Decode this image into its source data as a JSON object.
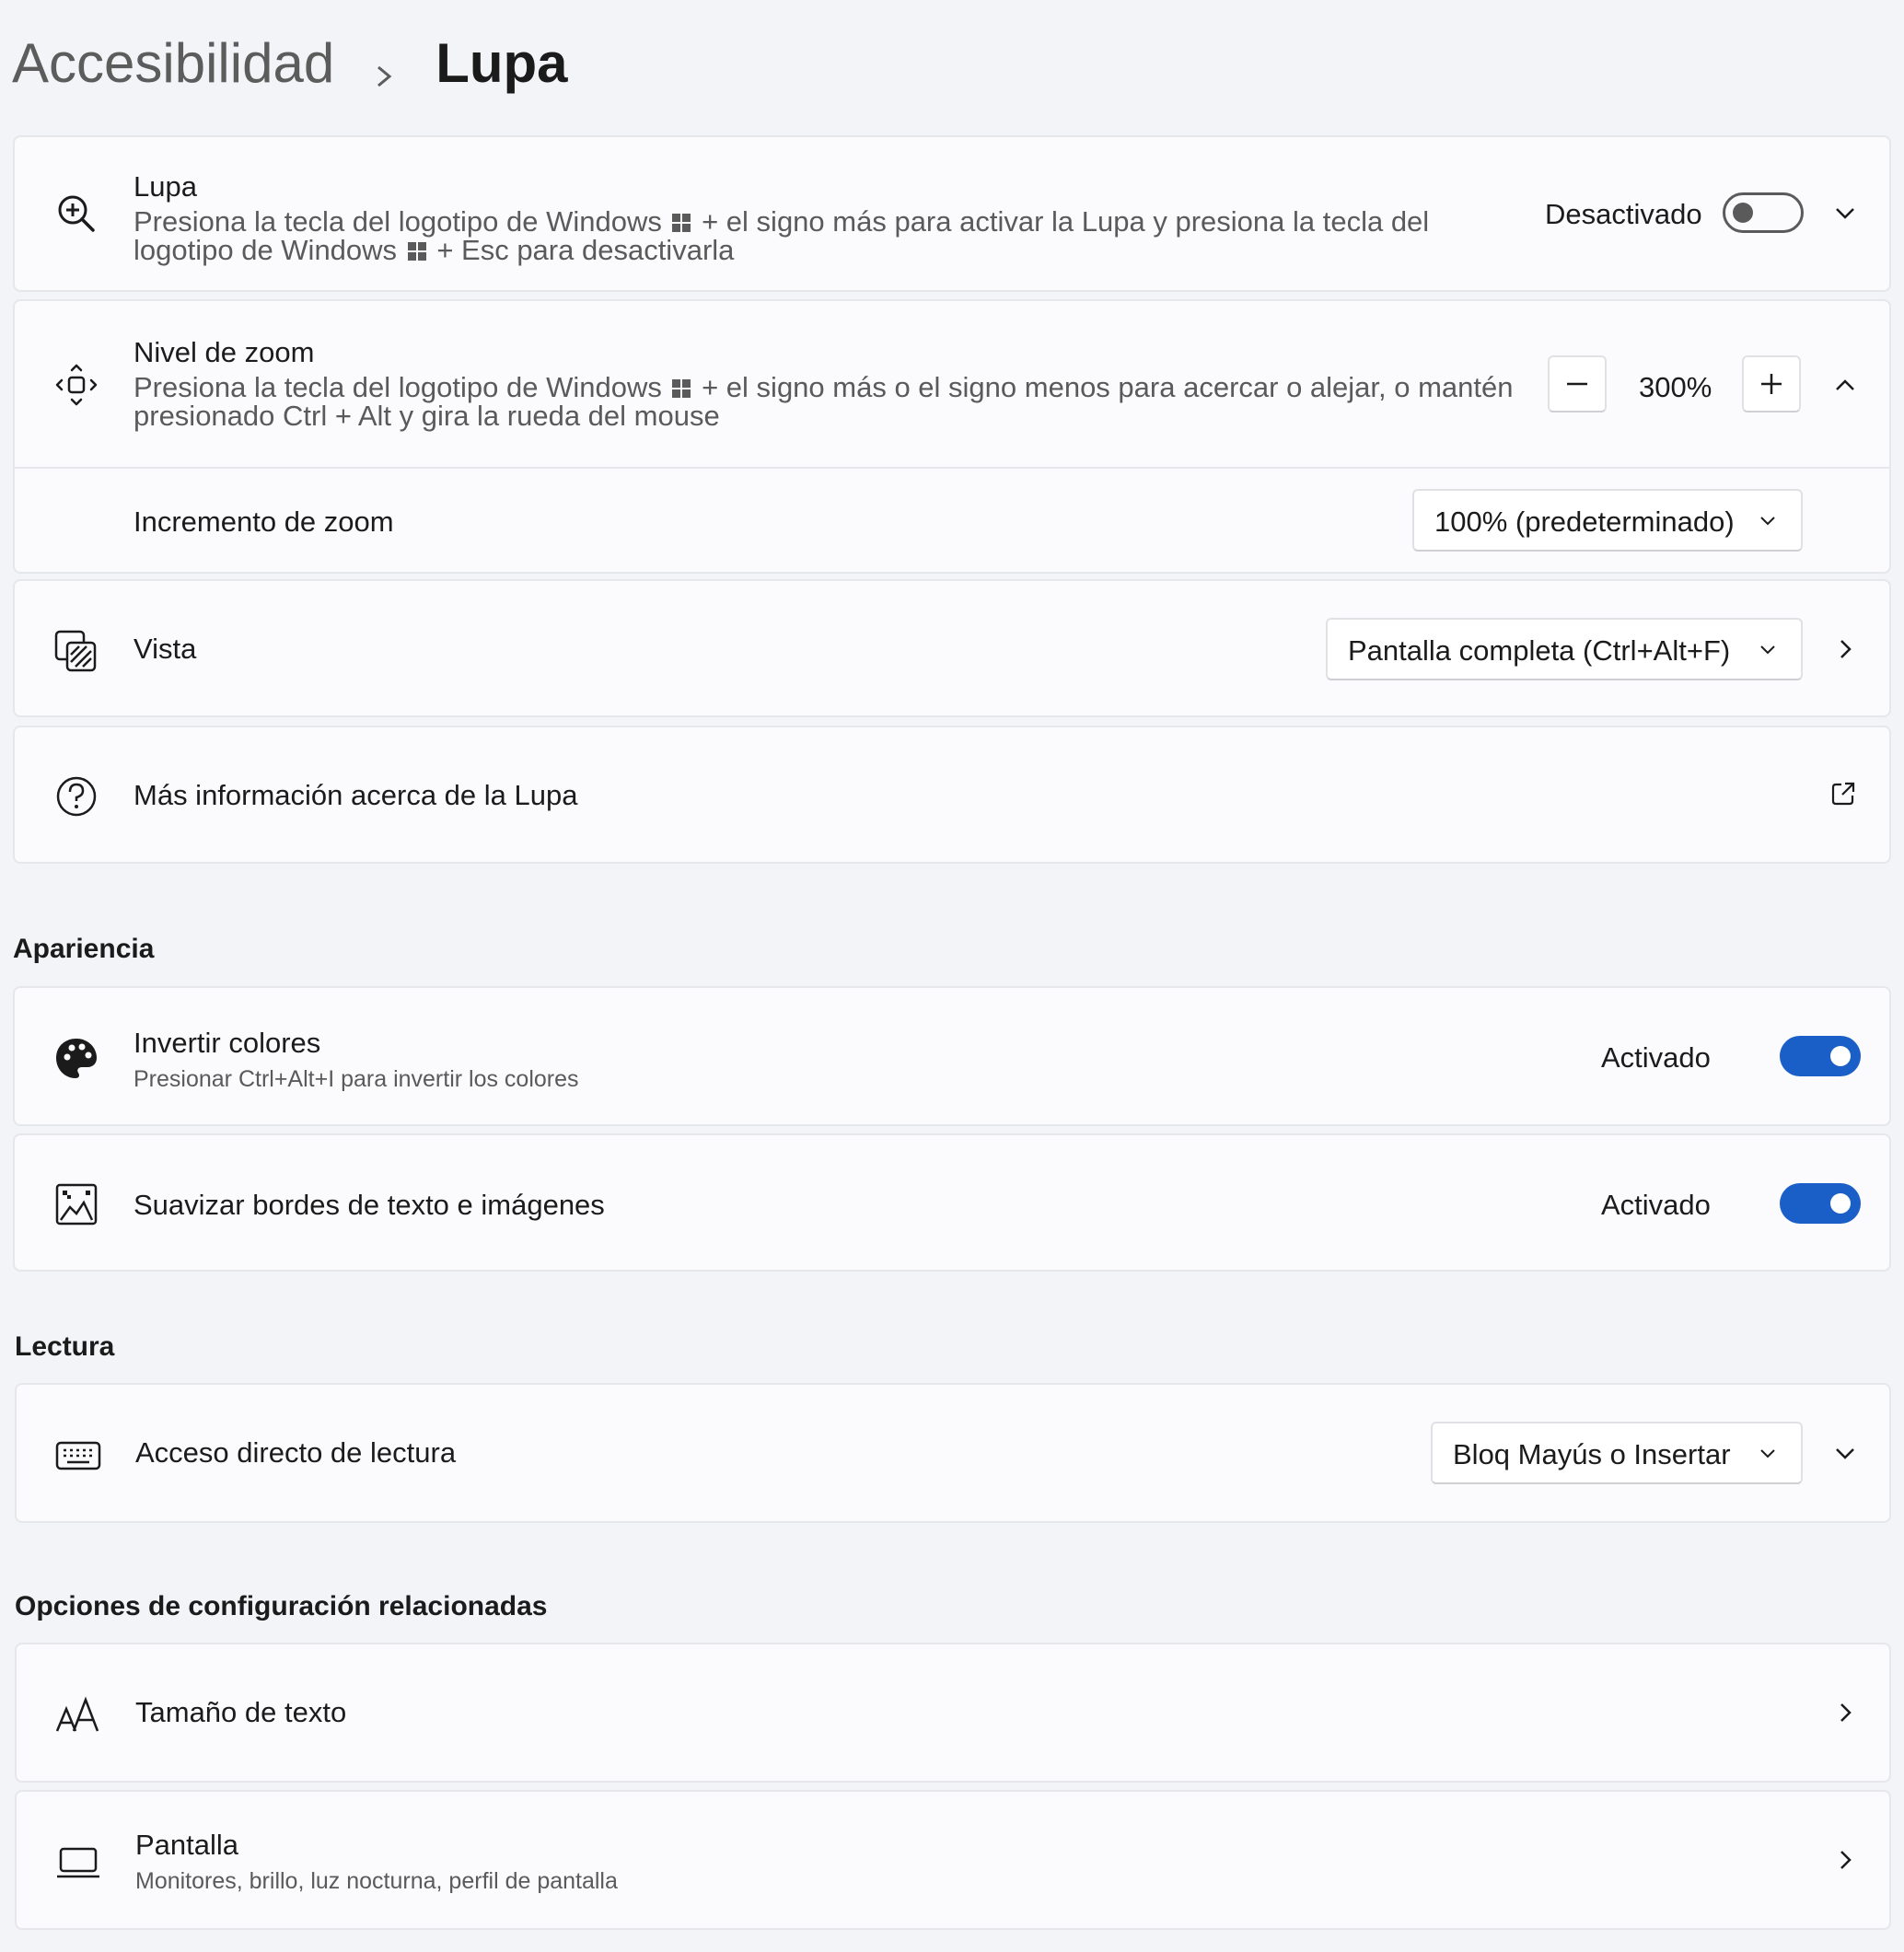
{
  "breadcrumb": {
    "parent": "Accesibilidad",
    "current": "Lupa"
  },
  "magnifier": {
    "title": "Lupa",
    "desc_part1": "Presiona la tecla del logotipo de Windows",
    "desc_part2": "+ el signo más para activar la Lupa y presiona la tecla del",
    "desc_part3": "logotipo de Windows",
    "desc_part4": "+ Esc para desactivarla",
    "status": "Desactivado",
    "toggle_on": false
  },
  "zoom": {
    "title": "Nivel de zoom",
    "desc_part1": "Presiona la tecla del logotipo de Windows",
    "desc_part2": "+ el signo más o el signo menos para acercar o alejar, o mantén",
    "desc_part3": "presionado Ctrl + Alt y gira la rueda del mouse",
    "value": "300%",
    "increment_label": "Incremento de zoom",
    "increment_value": "100% (predeterminado)"
  },
  "view": {
    "title": "Vista",
    "value": "Pantalla completa (Ctrl+Alt+F)"
  },
  "info": {
    "title": "Más información acerca de la Lupa"
  },
  "sections": {
    "appearance": "Apariencia",
    "reading": "Lectura",
    "related": "Opciones de configuración relacionadas"
  },
  "invert": {
    "title": "Invertir colores",
    "desc": "Presionar Ctrl+Alt+I para invertir los colores",
    "status": "Activado",
    "toggle_on": true
  },
  "smooth": {
    "title": "Suavizar bordes de texto e imágenes",
    "status": "Activado",
    "toggle_on": true
  },
  "reading_shortcut": {
    "title": "Acceso directo de lectura",
    "value": "Bloq Mayús o Insertar"
  },
  "text_size": {
    "title": "Tamaño de texto"
  },
  "display": {
    "title": "Pantalla",
    "desc": "Monitores, brillo, luz nocturna, perfil de pantalla"
  },
  "colors": {
    "accent": "#1a5fc8",
    "background": "#f3f4f8",
    "card": "#fbfbfd"
  },
  "icons": [
    "zoom-in-icon",
    "zoom-level-icon",
    "view-icon",
    "help-icon",
    "external-link-icon",
    "palette-icon",
    "smooth-edges-icon",
    "keyboard-icon",
    "text-size-icon",
    "display-icon",
    "windows-logo-icon",
    "chevron-down-icon",
    "chevron-up-icon",
    "chevron-right-icon",
    "minus-icon",
    "plus-icon"
  ]
}
